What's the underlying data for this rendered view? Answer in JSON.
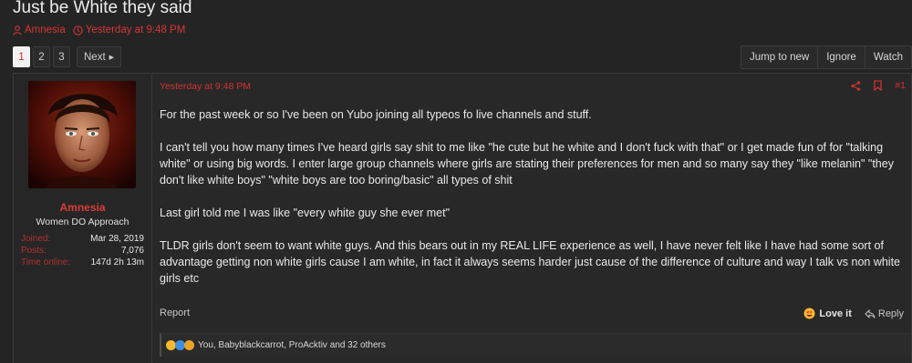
{
  "thread": {
    "title": "Just be White they said",
    "author": "Amnesia",
    "date": "Yesterday at 9:48 PM"
  },
  "pager": {
    "pages": [
      "1",
      "2",
      "3"
    ],
    "current": "1",
    "next_label": "Next"
  },
  "actions": {
    "jump": "Jump to new",
    "ignore": "Ignore",
    "watch": "Watch"
  },
  "user": {
    "name": "Amnesia",
    "title": "Women DO Approach",
    "stats": [
      {
        "label": "Joined:",
        "value": "Mar 28, 2019"
      },
      {
        "label": "Posts:",
        "value": "7,076"
      },
      {
        "label": "Time online:",
        "value": "147d 2h 13m"
      }
    ]
  },
  "post": {
    "date": "Yesterday at 9:48 PM",
    "number": "#1",
    "paragraphs": [
      "For the past week or so I've been on Yubo joining all typeos fo live channels and stuff.",
      "I can't tell you how many times I've heard girls say shit to me like \"he cute but he white and I don't fuck with that\" or I get made fun of for \"talking white\" or using big words. I enter large group channels where girls are stating their preferences for men and so many say they \"like melanin\" \"they don't like white boys\" \"white boys are too boring/basic\" all types of shit",
      "Last girl told me I was like \"every white guy she ever met\"",
      "TLDR girls don't seem to want white guys. And this bears out in my REAL LIFE experience as well, I have never felt like I have had some sort of advantage getting non white girls cause I am white, in fact it always seems harder just cause of the difference of culture and way I talk vs non white girls etc"
    ],
    "report": "Report",
    "love": "Love it",
    "reply": "Reply",
    "reactions": "You, Babyblackcarrot, ProAcktiv and 32 others"
  },
  "colors": {
    "accent": "#d83535",
    "background": "#242424"
  }
}
